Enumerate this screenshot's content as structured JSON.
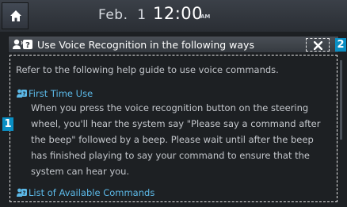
{
  "status_bar": {
    "date": "Feb.  1",
    "time": "12:00",
    "ampm": "AM"
  },
  "dialog": {
    "title": "Use Voice Recognition in the following ways",
    "intro": "Refer to the following help guide to use voice commands.",
    "sections": [
      {
        "heading": "First Time Use",
        "lines": [
          "When you press the voice recognition button on the steering",
          "wheel, you'll hear the system say \"Please say a command after",
          "the beep\" followed by a beep. Please wait until after the beep",
          "has finished playing to say your command to ensure that the",
          "system can hear you."
        ]
      },
      {
        "heading": "List of Available Commands"
      }
    ]
  },
  "callouts": {
    "content_area": "1",
    "close_button": "2"
  },
  "colors": {
    "accent": "#5cb9e8",
    "callout": "#0a8fc4",
    "background": "#1d2023"
  }
}
